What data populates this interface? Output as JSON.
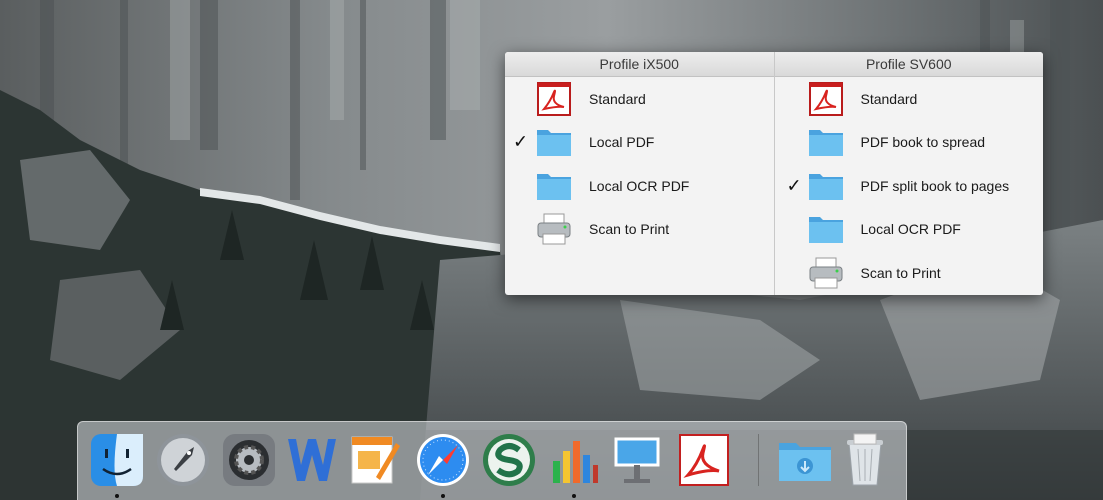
{
  "popup": {
    "columns": [
      {
        "header": "Profile iX500",
        "items": [
          {
            "label": "Standard",
            "icon": "pdf-icon",
            "checked": false
          },
          {
            "label": "Local PDF",
            "icon": "folder-icon",
            "checked": true
          },
          {
            "label": "Local OCR PDF",
            "icon": "folder-icon",
            "checked": false
          },
          {
            "label": "Scan to Print",
            "icon": "printer-icon",
            "checked": false
          }
        ]
      },
      {
        "header": "Profile SV600",
        "items": [
          {
            "label": "Standard",
            "icon": "pdf-icon",
            "checked": false
          },
          {
            "label": "PDF book to spread",
            "icon": "folder-icon",
            "checked": false
          },
          {
            "label": "PDF split book to pages",
            "icon": "folder-icon",
            "checked": true
          },
          {
            "label": "Local OCR PDF",
            "icon": "folder-icon",
            "checked": false
          },
          {
            "label": "Scan to Print",
            "icon": "printer-icon",
            "checked": false
          }
        ]
      }
    ],
    "check_glyph": "✓"
  },
  "dock": {
    "apps": [
      {
        "icon": "finder-icon",
        "running": true
      },
      {
        "icon": "launchpad-icon",
        "running": false
      },
      {
        "icon": "system-preferences-icon",
        "running": false
      },
      {
        "icon": "word-icon",
        "running": false
      },
      {
        "icon": "pages-icon",
        "running": false
      },
      {
        "icon": "safari-icon",
        "running": true
      },
      {
        "icon": "scansnap-icon",
        "running": false
      },
      {
        "icon": "numbers-icon",
        "running": true
      },
      {
        "icon": "keynote-icon",
        "running": false
      },
      {
        "icon": "acrobat-icon",
        "running": false
      }
    ],
    "stack": [
      {
        "icon": "downloads-folder-icon"
      },
      {
        "icon": "trash-icon"
      }
    ]
  },
  "colors": {
    "folder": "#5ab4ea",
    "pdf_red": "#d8231f",
    "menu_bg": "#f3f3f3"
  }
}
